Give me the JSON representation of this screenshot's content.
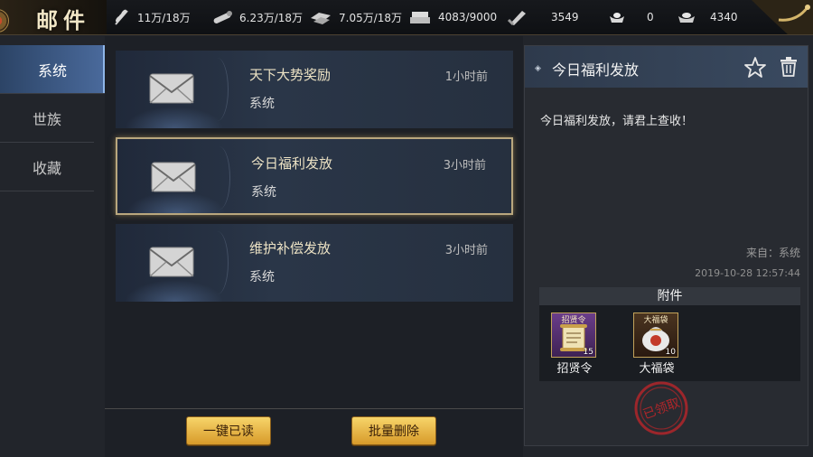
{
  "header": {
    "title": "邮件",
    "resources": [
      {
        "icon": "wheat-icon",
        "value": "11万/18万"
      },
      {
        "icon": "wood-icon",
        "value": "6.23万/18万"
      },
      {
        "icon": "iron-icon",
        "value": "7.05万/18万"
      },
      {
        "icon": "stone-icon",
        "value": "4083/9000"
      },
      {
        "icon": "token-icon",
        "value": "3549"
      },
      {
        "icon": "gold-ingot-icon",
        "value": "0"
      },
      {
        "icon": "silver-ingot-icon",
        "value": "4340"
      }
    ]
  },
  "tabs": [
    {
      "label": "系统",
      "active": true
    },
    {
      "label": "世族",
      "active": false
    },
    {
      "label": "收藏",
      "active": false
    }
  ],
  "mails": [
    {
      "subject": "天下大势奖励",
      "sender": "系统",
      "time": "1小时前",
      "selected": false
    },
    {
      "subject": "今日福利发放",
      "sender": "系统",
      "time": "3小时前",
      "selected": true
    },
    {
      "subject": "维护补偿发放",
      "sender": "系统",
      "time": "3小时前",
      "selected": false
    }
  ],
  "buttons": {
    "mark_all_read": "一键已读",
    "batch_delete": "批量删除"
  },
  "detail": {
    "title": "今日福利发放",
    "body": "今日福利发放，请君上查收！",
    "sender": "来自：系统",
    "date": "2019-10-28 12:57:44",
    "attachments_label": "附件",
    "attachments": [
      {
        "tag": "招贤令",
        "name": "招贤令",
        "qty": "15"
      },
      {
        "tag": "大福袋",
        "name": "大福袋",
        "qty": "10"
      }
    ],
    "stamp": "已领取"
  },
  "colors": {
    "accent_gold": "#d79a2a",
    "tab_active": "#4a6a9c",
    "stamp_red": "#b0262a"
  }
}
